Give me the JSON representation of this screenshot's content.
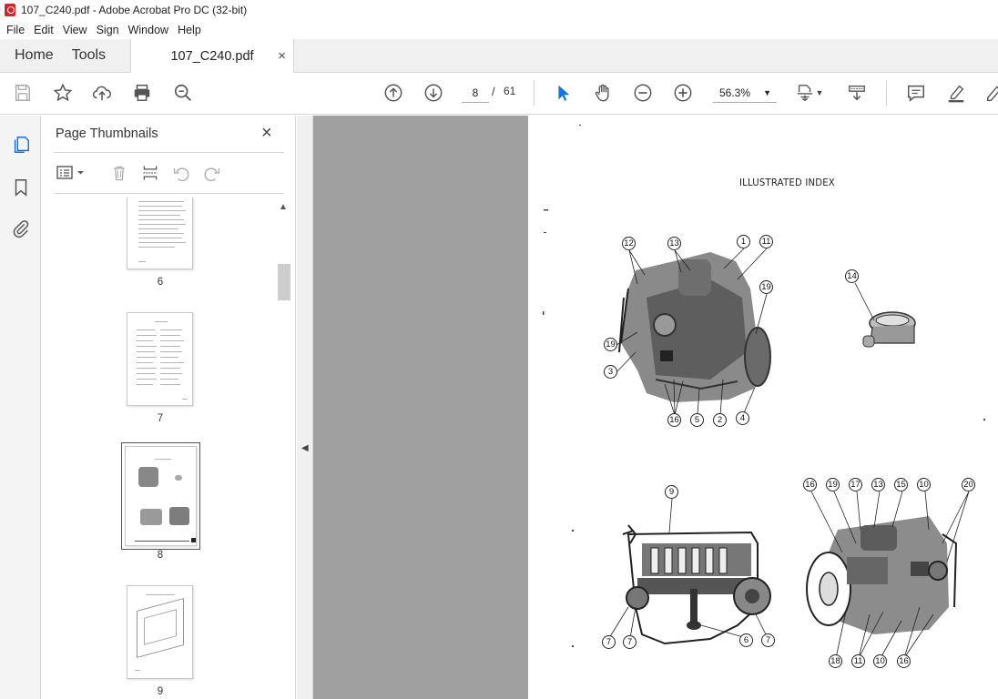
{
  "window": {
    "title": "107_C240.pdf - Adobe Acrobat Pro DC (32-bit)"
  },
  "menu": [
    "File",
    "Edit",
    "View",
    "Sign",
    "Window",
    "Help"
  ],
  "tabs": {
    "home": "Home",
    "tools": "Tools",
    "document": "107_C240.pdf",
    "close": "×"
  },
  "toolbar": {
    "current_page": "8",
    "page_sep": "/",
    "total_pages": "61",
    "zoom": "56.3%"
  },
  "thumbnails_panel": {
    "title": "Page Thumbnails",
    "close": "×",
    "pages": [
      {
        "label": "6"
      },
      {
        "label": "7"
      },
      {
        "label": "8",
        "selected": true
      },
      {
        "label": "9"
      }
    ]
  },
  "document": {
    "heading": "ILLUSTRATED INDEX",
    "callouts_top_left": [
      "12",
      "13",
      "1",
      "11",
      "19",
      "19",
      "3",
      "16",
      "5",
      "2",
      "4"
    ],
    "callouts_top_right": [
      "14"
    ],
    "callouts_bottom_left": [
      "9",
      "7",
      "7",
      "6",
      "7"
    ],
    "callouts_bottom_right": [
      "16",
      "19",
      "17",
      "13",
      "15",
      "10",
      "20",
      "18",
      "11",
      "10",
      "16"
    ]
  },
  "colors": {
    "accent": "#1473e6",
    "pdf_red": "#d3242b",
    "doc_background": "#a0a0a0"
  }
}
